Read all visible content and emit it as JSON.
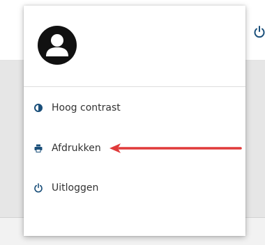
{
  "menu": {
    "items": [
      {
        "label": "Hoog contrast",
        "icon": "contrast-icon"
      },
      {
        "label": "Afdrukken",
        "icon": "printer-icon"
      },
      {
        "label": "Uitloggen",
        "icon": "power-icon"
      }
    ]
  },
  "colors": {
    "icon_blue": "#1a4f7a",
    "annotation_red": "#e03a3a",
    "avatar_bg": "#111111"
  }
}
